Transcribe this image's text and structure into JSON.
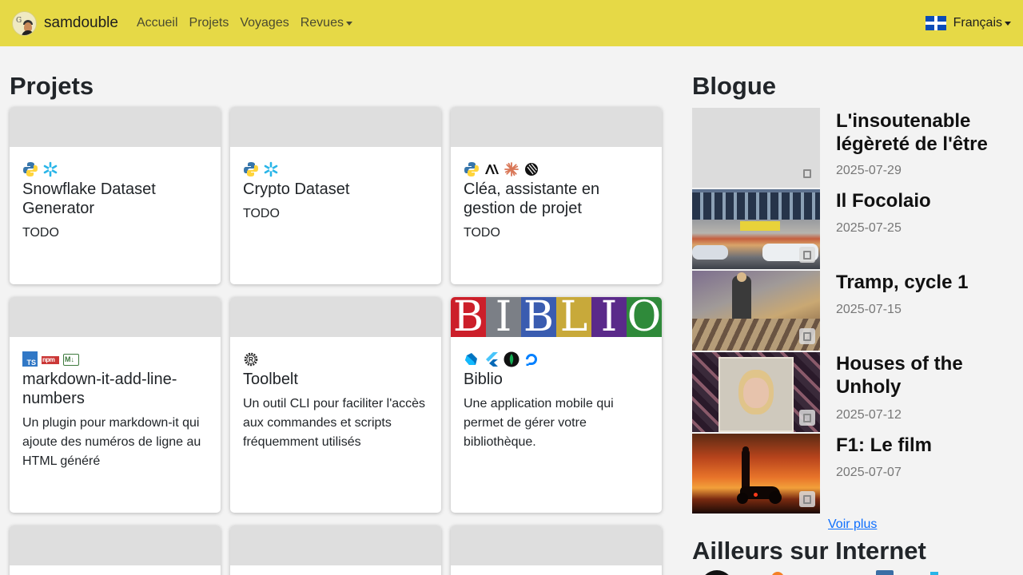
{
  "navbar": {
    "brand": "samdouble",
    "links": [
      "Accueil",
      "Projets",
      "Voyages",
      "Revues"
    ],
    "language": "Français",
    "background": "#e6d946"
  },
  "projects": {
    "heading": "Projets",
    "cards": [
      {
        "title": "Snowflake Dataset Generator",
        "description": "TODO",
        "icons": [
          "python-icon",
          "snowflake-icon"
        ]
      },
      {
        "title": "Crypto Dataset",
        "description": "TODO",
        "icons": [
          "python-icon",
          "snowflake-icon"
        ]
      },
      {
        "title": "Cléa, assistante en gestion de projet",
        "description": "TODO",
        "icons": [
          "python-icon",
          "anthropic-icon",
          "claude-icon",
          "openai-icon"
        ]
      },
      {
        "title": "markdown-it-add-line-numbers",
        "description": "Un plugin pour markdown-it qui ajoute des numéros de ligne au HTML généré",
        "icons": [
          "typescript-icon",
          "npm-icon",
          "markdown-icon"
        ],
        "icon_labels": [
          "TS",
          "npm",
          "M↓"
        ]
      },
      {
        "title": "Toolbelt",
        "description": "Un outil CLI pour faciliter l'accès aux commandes et scripts fréquemment utilisés",
        "icons": [
          "rust-icon"
        ]
      },
      {
        "title": "Biblio",
        "description": "Une application mobile qui permet de gérer votre bibliothèque.",
        "icons": [
          "dart-icon",
          "flutter-icon",
          "mongodb-icon",
          "digitalocean-icon"
        ],
        "banner": "BIBLIO"
      }
    ]
  },
  "blog": {
    "heading": "Blogue",
    "posts": [
      {
        "title": "L'insoutenable légèreté de l'être",
        "date": "2025-07-29"
      },
      {
        "title": "Il Focolaio",
        "date": "2025-07-25"
      },
      {
        "title": "Tramp, cycle 1",
        "date": "2025-07-15"
      },
      {
        "title": "Houses of the Unholy",
        "date": "2025-07-12"
      },
      {
        "title": "F1: Le film",
        "date": "2025-07-07"
      }
    ],
    "more": "Voir plus"
  },
  "elsewhere": {
    "heading": "Ailleurs sur Internet"
  }
}
